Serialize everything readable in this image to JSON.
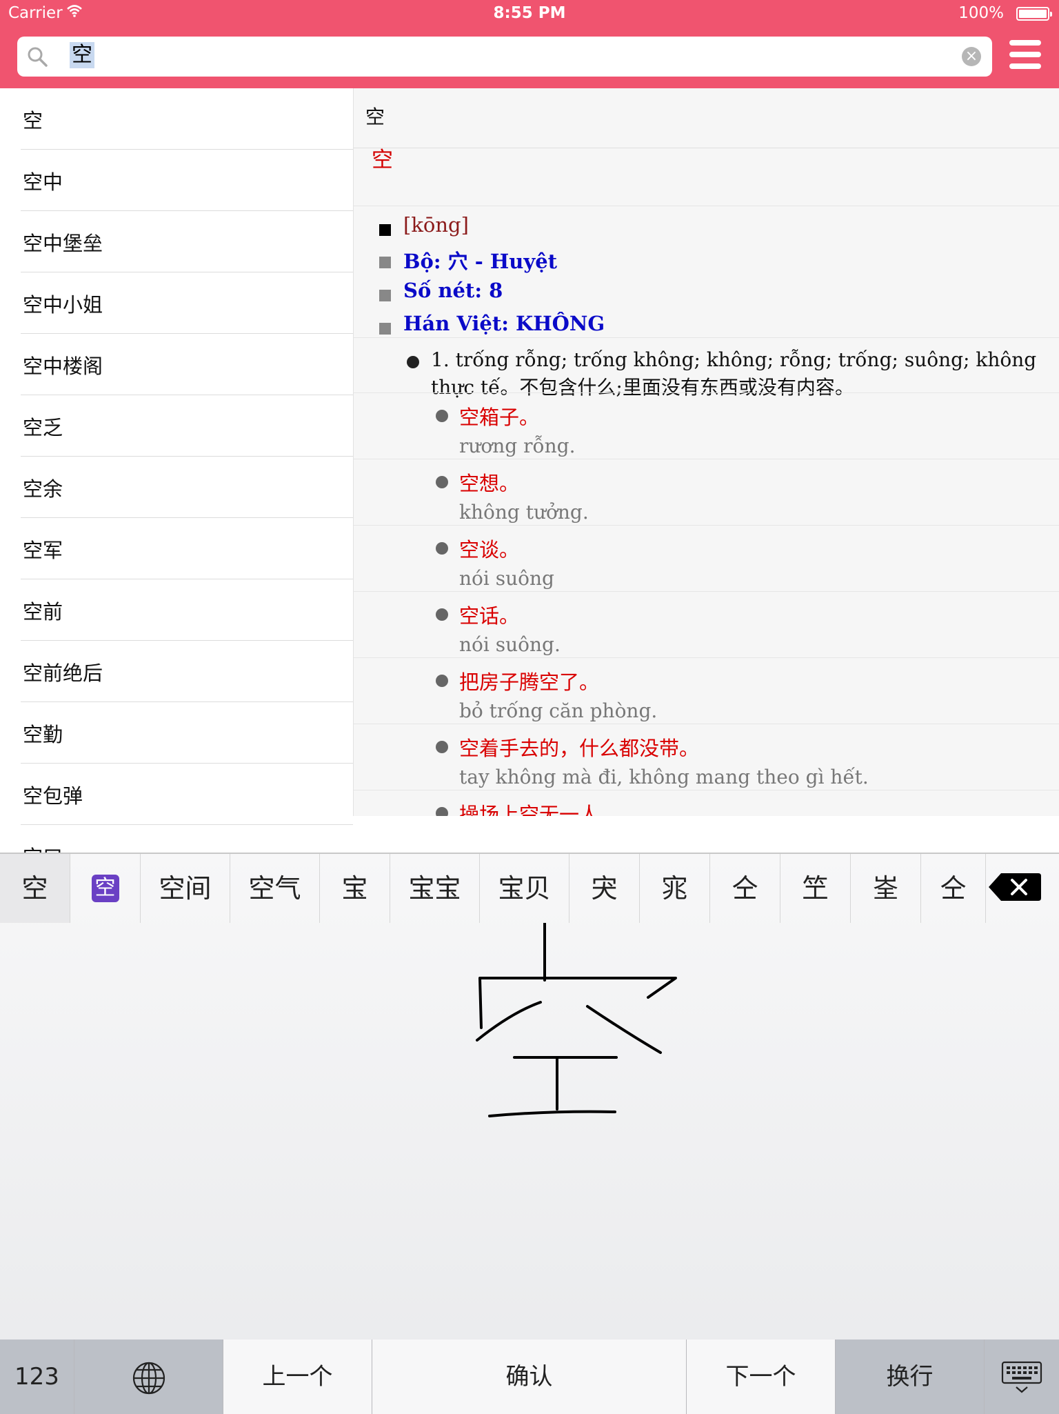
{
  "status_bar": {
    "carrier": "Carrier",
    "time": "8:55 PM",
    "battery": "100%"
  },
  "search": {
    "query": "空"
  },
  "word_list": [
    "空",
    "空中",
    "空中堡垒",
    "空中小姐",
    "空中楼阁",
    "空乏",
    "空余",
    "空军",
    "空前",
    "空前绝后",
    "空勤",
    "空包弹",
    "空口"
  ],
  "detail": {
    "headword": "空",
    "character": "空",
    "pinyin": "[kōng]",
    "radical": "Bộ: 穴 - Huyệt",
    "strokes": "Số nét: 8",
    "han_viet": "Hán Việt: KHÔNG",
    "definition": "1. trống rỗng; trống không; không; rỗng; trống; suông; không thực tế。不包含什么;里面没有东西或没有内容。",
    "examples": [
      {
        "zh": "空箱子。",
        "vi": "rương rỗng."
      },
      {
        "zh": "空想。",
        "vi": "không tưởng."
      },
      {
        "zh": "空谈。",
        "vi": "nói suông"
      },
      {
        "zh": "空话。",
        "vi": "nói suông."
      },
      {
        "zh": "把房子腾空了。",
        "vi": "bỏ trống căn phòng."
      },
      {
        "zh": "空着手去的，什么都没带。",
        "vi": "tay không mà đi, không mang theo gì hết."
      },
      {
        "zh": "操场上空无一人。",
        "vi": ""
      }
    ]
  },
  "keyboard": {
    "candidates": [
      "空",
      "空",
      "空间",
      "空气",
      "宝",
      "宝宝",
      "宝贝",
      "宊",
      "宨",
      "仝",
      "笁",
      "峑",
      "仝"
    ],
    "keys": {
      "numbers": "123",
      "prev": "上一个",
      "confirm": "确认",
      "next": "下一个",
      "return": "换行"
    }
  },
  "colors": {
    "header": "#f0546f",
    "example_red": "#d90000",
    "label_blue": "#0a0ac8",
    "pinyin_brown": "#8b1a1a"
  }
}
